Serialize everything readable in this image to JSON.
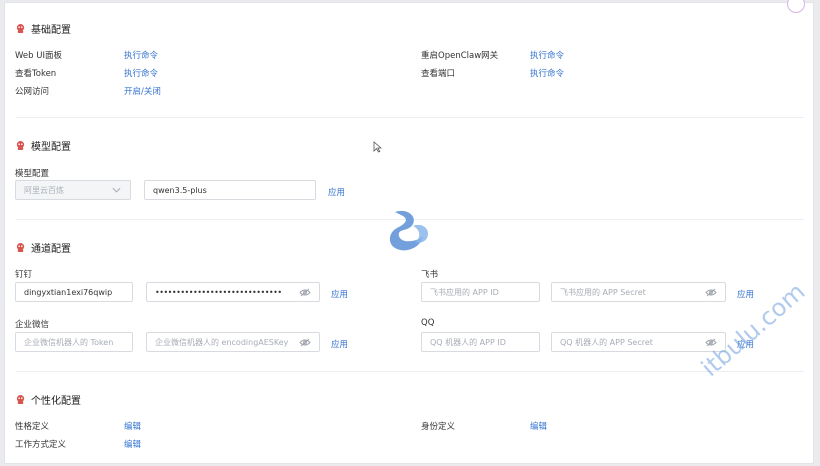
{
  "sections": {
    "basic": {
      "title": "基础配置",
      "rows": [
        {
          "label": "Web UI面板",
          "action": "执行命令"
        },
        {
          "label": "查看Token",
          "action": "执行命令"
        },
        {
          "label": "公网访问",
          "action": "开启/关闭"
        },
        {
          "label": "重启OpenClaw网关",
          "action": "执行命令"
        },
        {
          "label": "查看端口",
          "action": "执行命令"
        }
      ]
    },
    "model": {
      "title": "模型配置",
      "field_label": "模型配置",
      "provider_select": "阿里云百炼",
      "model_input": "qwen3.5-plus",
      "apply": "应用"
    },
    "channel": {
      "title": "通道配置",
      "dingtalk": {
        "label": "钉钉",
        "app_key": "dingyxtian1exi76qwip",
        "secret_masked": "••••••••••••••••••••••••••••••",
        "apply": "应用"
      },
      "feishu": {
        "label": "飞书",
        "app_id_placeholder": "飞书应用的 APP ID",
        "secret_placeholder": "飞书应用的 APP Secret",
        "apply": "应用"
      },
      "wecom": {
        "label": "企业微信",
        "token_placeholder": "企业微信机器人的 Token",
        "aeskey_placeholder": "企业微信机器人的 encodingAESKey",
        "apply": "应用"
      },
      "qq": {
        "label": "QQ",
        "app_id_placeholder": "QQ 机器人的 APP ID",
        "secret_placeholder": "QQ 机器人的 APP Secret",
        "apply": "应用"
      }
    },
    "personal": {
      "title": "个性化配置",
      "rows": [
        {
          "label": "性格定义",
          "action": "编辑"
        },
        {
          "label": "工作方式定义",
          "action": "编辑"
        },
        {
          "label": "身份定义",
          "action": "编辑"
        }
      ]
    }
  },
  "watermark": "itbulu.com",
  "colors": {
    "link": "#3473d1",
    "icon_red": "#d9534f",
    "watermark": "#6f9fe0"
  }
}
